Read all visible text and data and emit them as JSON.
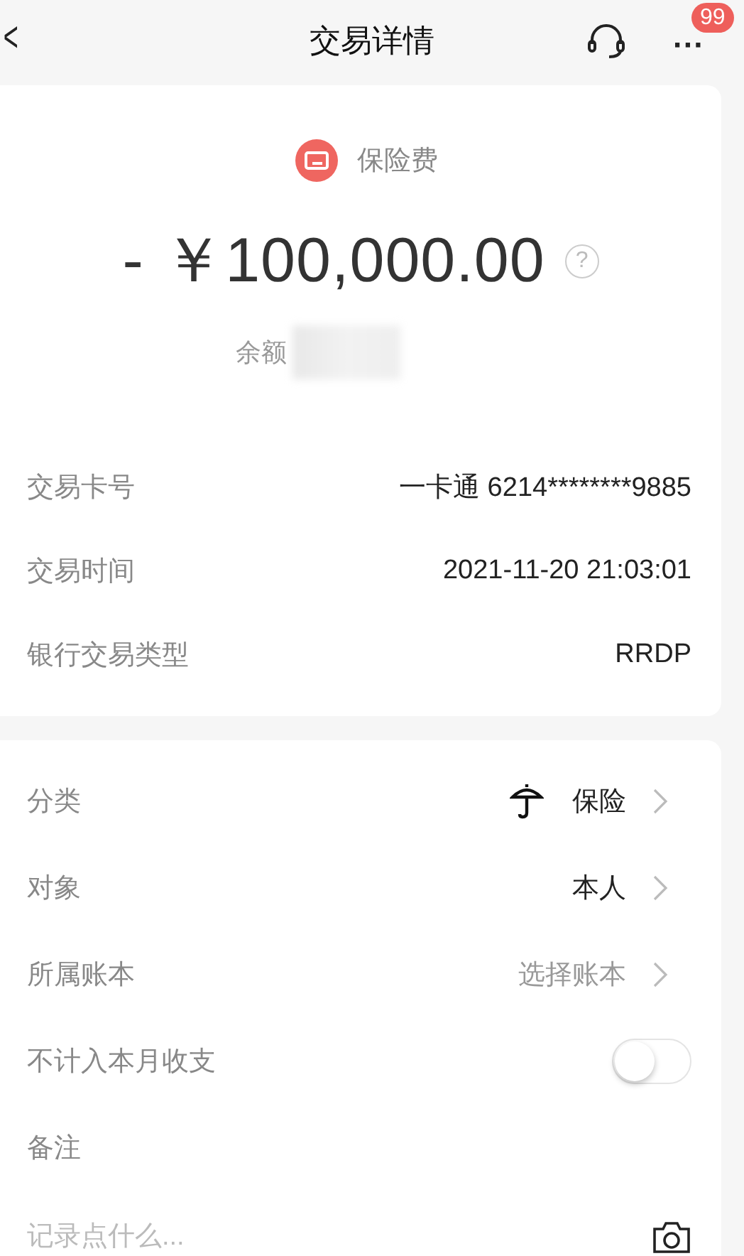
{
  "header": {
    "back": "<",
    "title": "交易详情",
    "badge": "99",
    "more": "···"
  },
  "summary": {
    "category": "保险费",
    "amount": "- ￥100,000.00",
    "help": "?",
    "balance_label": "余额"
  },
  "details": [
    {
      "label": "交易卡号",
      "value": "一卡通 6214********9885"
    },
    {
      "label": "交易时间",
      "value": "2021-11-20 21:03:01"
    },
    {
      "label": "银行交易类型",
      "value": "RRDP"
    }
  ],
  "settings": [
    {
      "kind": "link",
      "label": "分类",
      "value": "保险",
      "has_icon": true,
      "muted": false
    },
    {
      "kind": "link",
      "label": "对象",
      "value": "本人",
      "has_icon": false,
      "muted": false
    },
    {
      "kind": "link",
      "label": "所属账本",
      "value": "选择账本",
      "has_icon": false,
      "muted": true
    },
    {
      "kind": "toggle",
      "label": "不计入本月收支",
      "on": false
    },
    {
      "kind": "heading",
      "label": "备注"
    }
  ],
  "note": {
    "placeholder": "记录点什么..."
  }
}
